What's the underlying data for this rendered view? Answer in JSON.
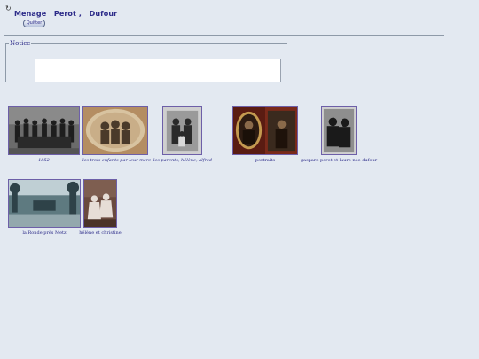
{
  "header": {
    "title": "Menage   Perot ,   Dufour",
    "quit_label": "Quitter",
    "corner_icon": "collapse-arrow-icon"
  },
  "notice": {
    "legend": "Notice",
    "value": ""
  },
  "gallery": {
    "items": [
      {
        "caption": "1852"
      },
      {
        "caption": "les trois enfants par leur mère"
      },
      {
        "caption": "les parents, hélène, alfred"
      },
      {
        "caption": "portraits"
      },
      {
        "caption": "gaspard perot et laure née dufour"
      },
      {
        "caption": "la Ronde près Metz"
      },
      {
        "caption": "hélène et christine"
      }
    ]
  },
  "colors": {
    "background": "#e3e9f1",
    "link_text": "#2b2a88",
    "border": "#8e9aa8"
  }
}
